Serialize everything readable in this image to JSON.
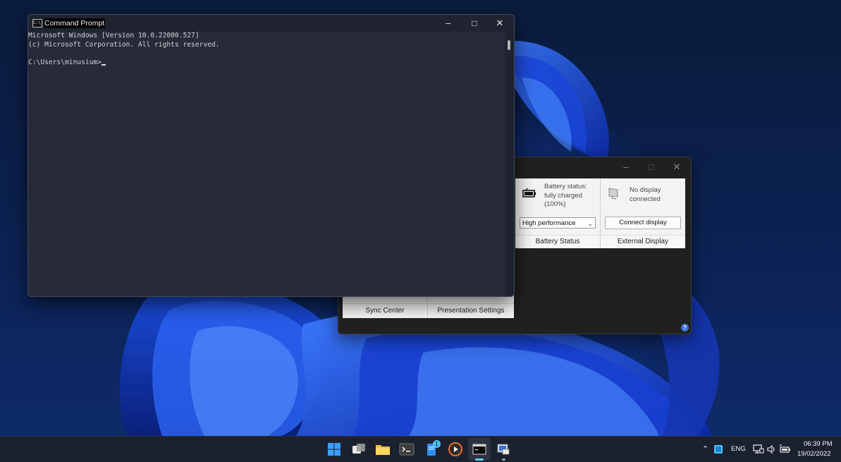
{
  "cmd": {
    "title": "Command Prompt",
    "lines": [
      "Microsoft Windows [Version 10.0.22000.527]",
      "(c) Microsoft Corporation. All rights reserved.",
      "",
      "C:\\Users\\minusium>"
    ]
  },
  "mobility_center": {
    "battery": {
      "status_line1": "Battery status:",
      "status_line2": "fully charged",
      "status_line3": "(100%)",
      "plan": "High performance",
      "footer": "Battery Status"
    },
    "display": {
      "status_line1": "No display",
      "status_line2": "connected",
      "button": "Connect display",
      "footer": "External Display"
    },
    "sync_footer": "Sync Center",
    "presentation_footer": "Presentation Settings",
    "help": "?"
  },
  "taskbar": {
    "badge": "1",
    "language": "ENG",
    "time": "06:39 PM",
    "date": "19/02/2022"
  },
  "colors": {
    "accent": "#60cdff",
    "taskbar": "#1c2130"
  }
}
